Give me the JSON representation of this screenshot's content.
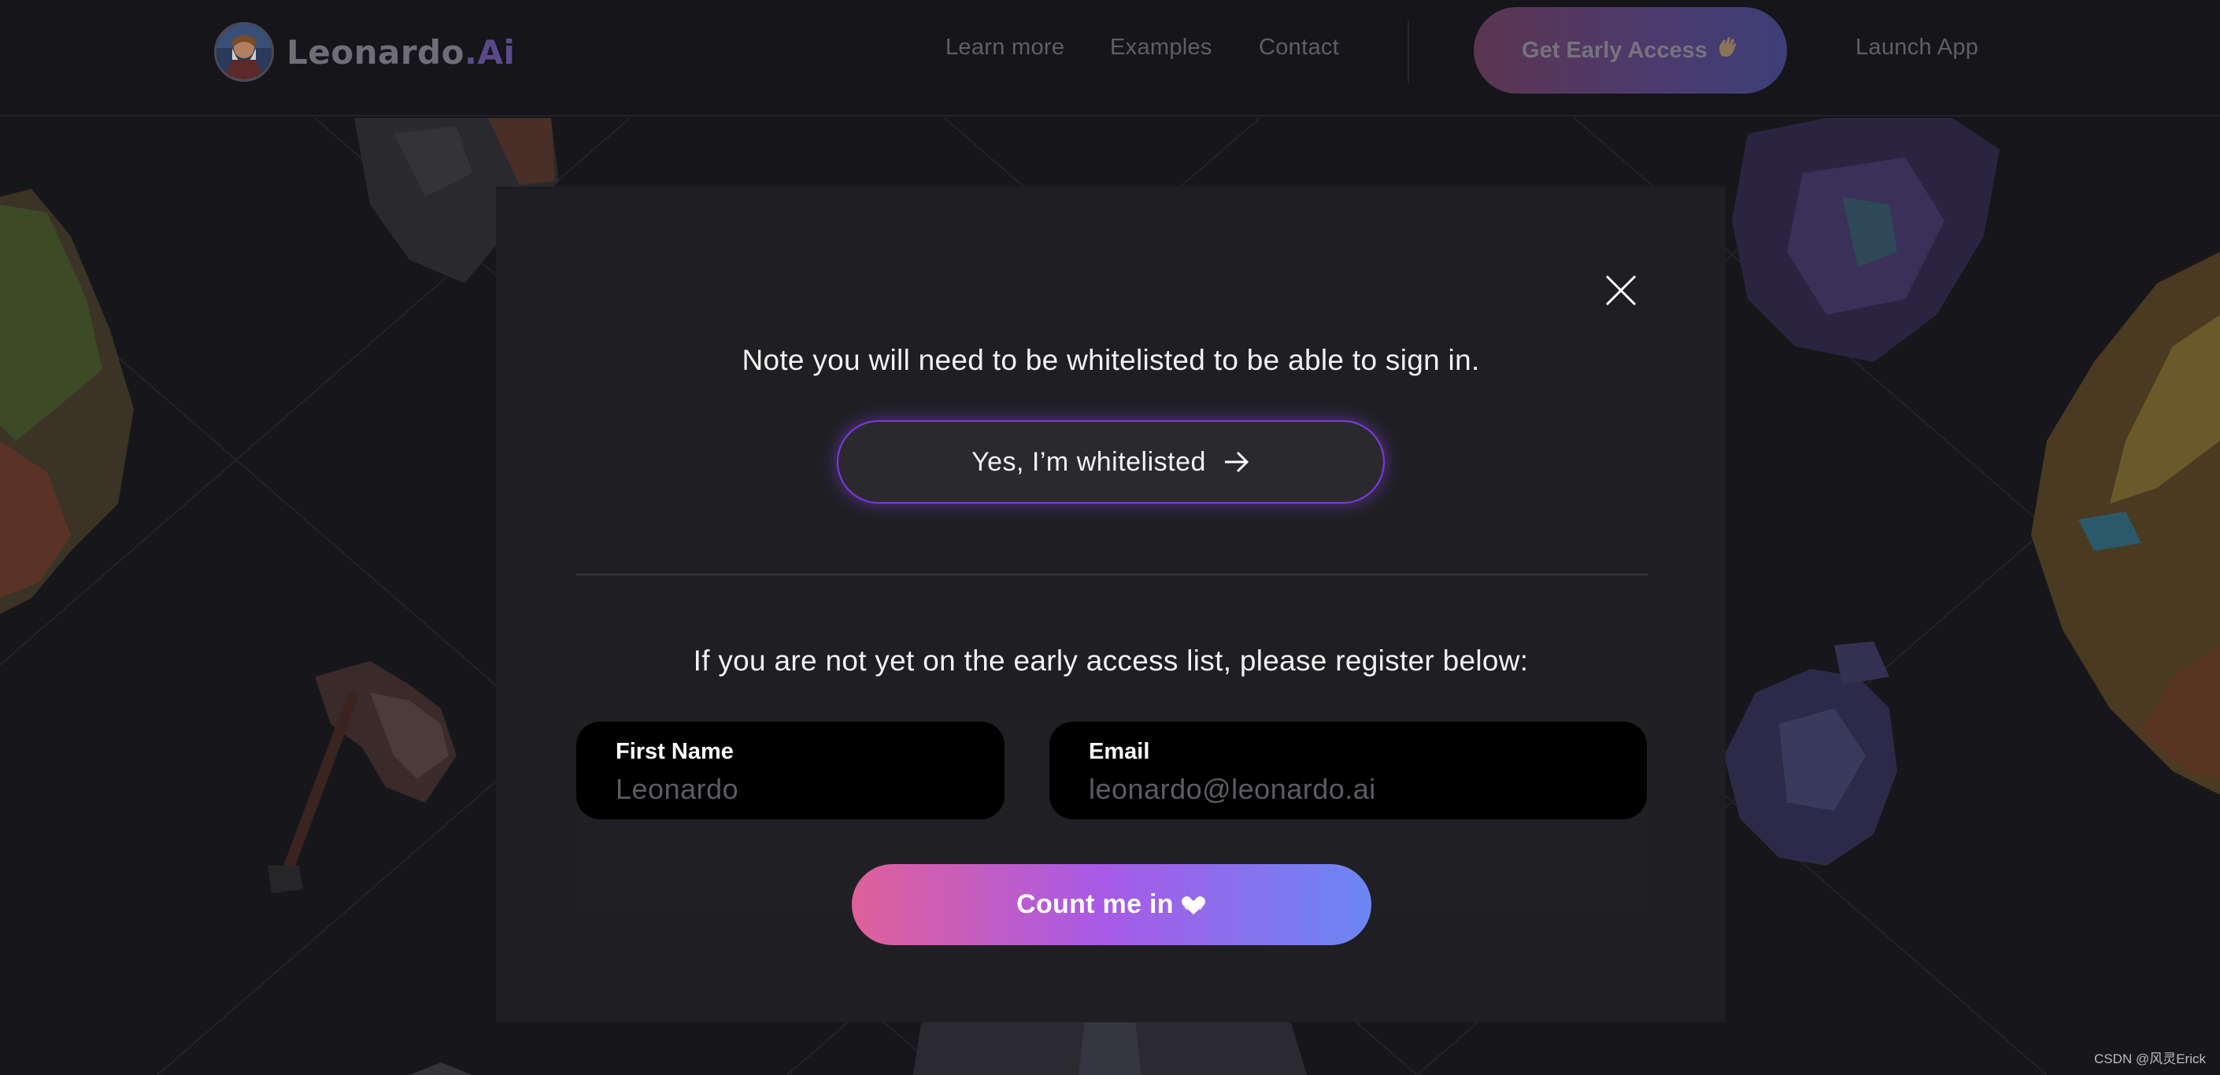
{
  "header": {
    "logo_text_main": "Leonardo",
    "logo_text_accent": ".Ai",
    "nav": [
      "Learn more",
      "Examples",
      "Contact"
    ],
    "early_access_label": "Get Early Access",
    "early_access_emoji": "👋",
    "launch_app_label": "Launch App"
  },
  "modal": {
    "note": "Note you will need to be whitelisted to be able to sign in.",
    "whitelisted_button": "Yes, I’m whitelisted",
    "register_prompt": "If you are not yet on the early access list, please register below:",
    "first_name_label": "First Name",
    "first_name_placeholder": "Leonardo",
    "first_name_value": "",
    "email_label": "Email",
    "email_placeholder": "leonardo@leonardo.ai",
    "email_value": "",
    "submit_label": "Count me in"
  },
  "watermark": "CSDN @风灵Erick",
  "colors": {
    "accent_purple": "#7c3ae0",
    "gradient_start": "#e0609a",
    "gradient_mid": "#a85ae6",
    "gradient_end": "#6c86f4",
    "modal_bg": "#1f1f23"
  },
  "icons": [
    "close-icon",
    "arrow-right-icon",
    "heart-hands-icon",
    "waving-hand-icon",
    "logo-avatar"
  ]
}
